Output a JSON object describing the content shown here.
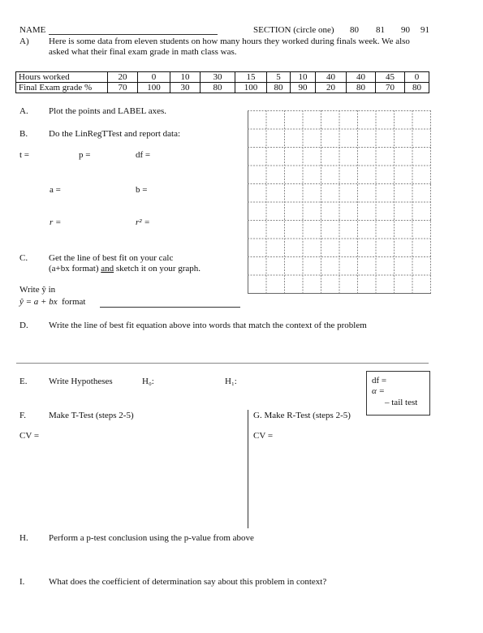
{
  "header": {
    "name_label": "NAME",
    "section_label": "SECTION (circle one)",
    "sections": [
      "80",
      "81",
      "90",
      "91"
    ]
  },
  "partA": {
    "label": "A)",
    "line1": "Here is some data from eleven students on how many hours they worked during finals week. We also",
    "line2": "asked what their final exam grade in math class was."
  },
  "table": {
    "rows": [
      {
        "label": "Hours worked",
        "values": [
          "20",
          "0",
          "10",
          "30",
          "15",
          "5",
          "10",
          "40",
          "40",
          "45",
          "0"
        ]
      },
      {
        "label": "Final Exam grade %",
        "values": [
          "70",
          "100",
          "30",
          "80",
          "100",
          "80",
          "90",
          "20",
          "80",
          "70",
          "80"
        ]
      }
    ]
  },
  "items": {
    "a_label": "A.",
    "a_text": "Plot the points and LABEL axes.",
    "b_label": "B.",
    "b_text": "Do the LinRegTTest and report data:",
    "t": "t =",
    "p": "p =",
    "df": "df =",
    "a": "a =",
    "b": "b =",
    "r": "r =",
    "r2": "r² =",
    "c_label": "C.",
    "c_line1": "Get the line of best fit on your calc",
    "c_line2a": "(a+bx format) ",
    "c_line2b": "and",
    "c_line2c": " sketch it on your graph.",
    "write1": "Write ŷ in",
    "write2": "ŷ = a + bx",
    "write3": "format",
    "d_label": "D.",
    "d_text": "Write the line of best fit equation above into words that match the context of the problem",
    "e_label": "E.",
    "e_text": "Write Hypotheses",
    "h0": "H₀:",
    "h1": "H₁:",
    "box_df": "df =",
    "box_alpha": "α =",
    "box_tail": "– tail test",
    "f_label": "F.",
    "f_text": "Make T-Test (steps 2-5)",
    "g_text": "G. Make R-Test (steps 2-5)",
    "cv_left": "CV =",
    "cv_right": "CV =",
    "h_label": "H.",
    "h_text": "Perform a p-test conclusion using the p-value from above",
    "i_label": "I.",
    "i_text": "What does the coefficient of determination say about this problem in context?"
  }
}
